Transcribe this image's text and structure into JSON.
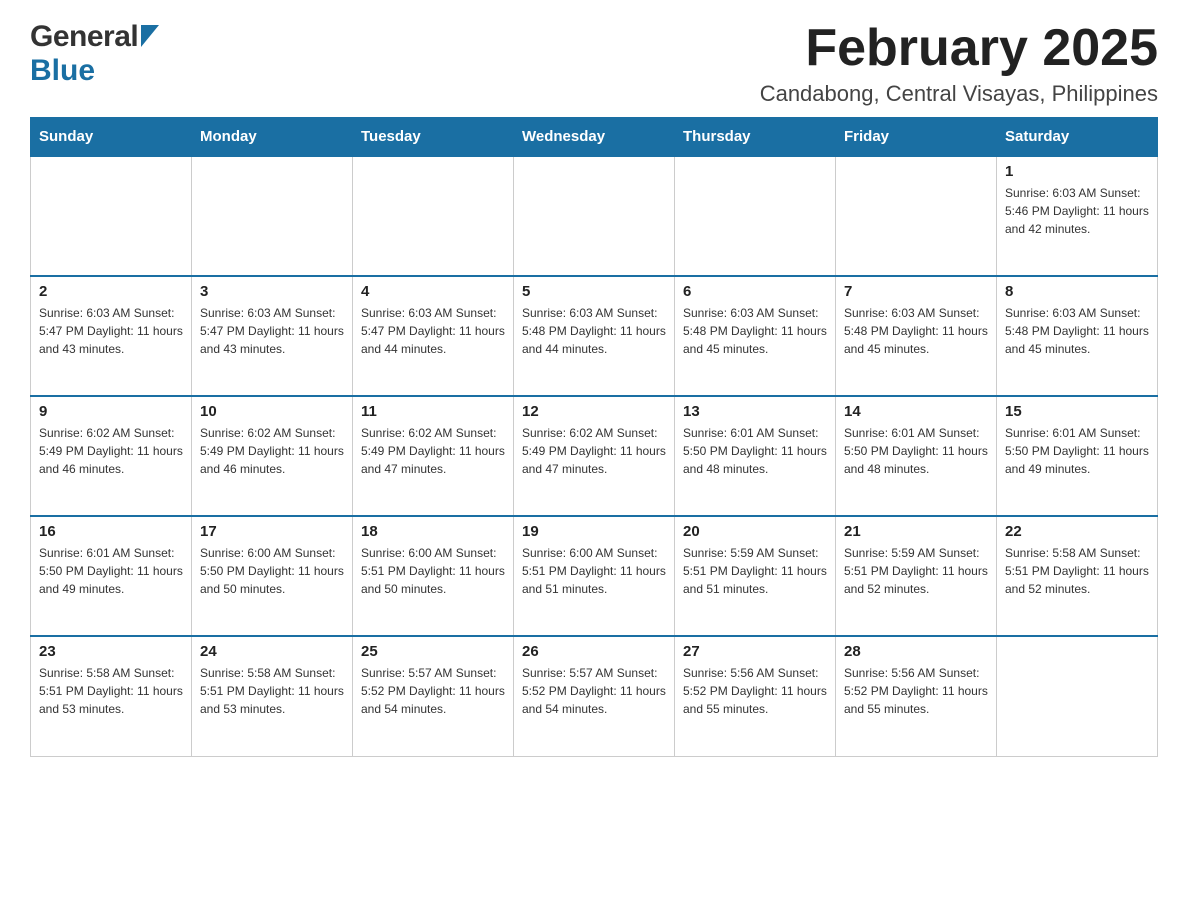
{
  "logo": {
    "general": "General",
    "blue": "Blue"
  },
  "title": {
    "month_year": "February 2025",
    "location": "Candabong, Central Visayas, Philippines"
  },
  "header_days": [
    "Sunday",
    "Monday",
    "Tuesday",
    "Wednesday",
    "Thursday",
    "Friday",
    "Saturday"
  ],
  "weeks": [
    {
      "days": [
        {
          "num": "",
          "info": ""
        },
        {
          "num": "",
          "info": ""
        },
        {
          "num": "",
          "info": ""
        },
        {
          "num": "",
          "info": ""
        },
        {
          "num": "",
          "info": ""
        },
        {
          "num": "",
          "info": ""
        },
        {
          "num": "1",
          "info": "Sunrise: 6:03 AM\nSunset: 5:46 PM\nDaylight: 11 hours and 42 minutes."
        }
      ]
    },
    {
      "days": [
        {
          "num": "2",
          "info": "Sunrise: 6:03 AM\nSunset: 5:47 PM\nDaylight: 11 hours and 43 minutes."
        },
        {
          "num": "3",
          "info": "Sunrise: 6:03 AM\nSunset: 5:47 PM\nDaylight: 11 hours and 43 minutes."
        },
        {
          "num": "4",
          "info": "Sunrise: 6:03 AM\nSunset: 5:47 PM\nDaylight: 11 hours and 44 minutes."
        },
        {
          "num": "5",
          "info": "Sunrise: 6:03 AM\nSunset: 5:48 PM\nDaylight: 11 hours and 44 minutes."
        },
        {
          "num": "6",
          "info": "Sunrise: 6:03 AM\nSunset: 5:48 PM\nDaylight: 11 hours and 45 minutes."
        },
        {
          "num": "7",
          "info": "Sunrise: 6:03 AM\nSunset: 5:48 PM\nDaylight: 11 hours and 45 minutes."
        },
        {
          "num": "8",
          "info": "Sunrise: 6:03 AM\nSunset: 5:48 PM\nDaylight: 11 hours and 45 minutes."
        }
      ]
    },
    {
      "days": [
        {
          "num": "9",
          "info": "Sunrise: 6:02 AM\nSunset: 5:49 PM\nDaylight: 11 hours and 46 minutes."
        },
        {
          "num": "10",
          "info": "Sunrise: 6:02 AM\nSunset: 5:49 PM\nDaylight: 11 hours and 46 minutes."
        },
        {
          "num": "11",
          "info": "Sunrise: 6:02 AM\nSunset: 5:49 PM\nDaylight: 11 hours and 47 minutes."
        },
        {
          "num": "12",
          "info": "Sunrise: 6:02 AM\nSunset: 5:49 PM\nDaylight: 11 hours and 47 minutes."
        },
        {
          "num": "13",
          "info": "Sunrise: 6:01 AM\nSunset: 5:50 PM\nDaylight: 11 hours and 48 minutes."
        },
        {
          "num": "14",
          "info": "Sunrise: 6:01 AM\nSunset: 5:50 PM\nDaylight: 11 hours and 48 minutes."
        },
        {
          "num": "15",
          "info": "Sunrise: 6:01 AM\nSunset: 5:50 PM\nDaylight: 11 hours and 49 minutes."
        }
      ]
    },
    {
      "days": [
        {
          "num": "16",
          "info": "Sunrise: 6:01 AM\nSunset: 5:50 PM\nDaylight: 11 hours and 49 minutes."
        },
        {
          "num": "17",
          "info": "Sunrise: 6:00 AM\nSunset: 5:50 PM\nDaylight: 11 hours and 50 minutes."
        },
        {
          "num": "18",
          "info": "Sunrise: 6:00 AM\nSunset: 5:51 PM\nDaylight: 11 hours and 50 minutes."
        },
        {
          "num": "19",
          "info": "Sunrise: 6:00 AM\nSunset: 5:51 PM\nDaylight: 11 hours and 51 minutes."
        },
        {
          "num": "20",
          "info": "Sunrise: 5:59 AM\nSunset: 5:51 PM\nDaylight: 11 hours and 51 minutes."
        },
        {
          "num": "21",
          "info": "Sunrise: 5:59 AM\nSunset: 5:51 PM\nDaylight: 11 hours and 52 minutes."
        },
        {
          "num": "22",
          "info": "Sunrise: 5:58 AM\nSunset: 5:51 PM\nDaylight: 11 hours and 52 minutes."
        }
      ]
    },
    {
      "days": [
        {
          "num": "23",
          "info": "Sunrise: 5:58 AM\nSunset: 5:51 PM\nDaylight: 11 hours and 53 minutes."
        },
        {
          "num": "24",
          "info": "Sunrise: 5:58 AM\nSunset: 5:51 PM\nDaylight: 11 hours and 53 minutes."
        },
        {
          "num": "25",
          "info": "Sunrise: 5:57 AM\nSunset: 5:52 PM\nDaylight: 11 hours and 54 minutes."
        },
        {
          "num": "26",
          "info": "Sunrise: 5:57 AM\nSunset: 5:52 PM\nDaylight: 11 hours and 54 minutes."
        },
        {
          "num": "27",
          "info": "Sunrise: 5:56 AM\nSunset: 5:52 PM\nDaylight: 11 hours and 55 minutes."
        },
        {
          "num": "28",
          "info": "Sunrise: 5:56 AM\nSunset: 5:52 PM\nDaylight: 11 hours and 55 minutes."
        },
        {
          "num": "",
          "info": ""
        }
      ]
    }
  ]
}
